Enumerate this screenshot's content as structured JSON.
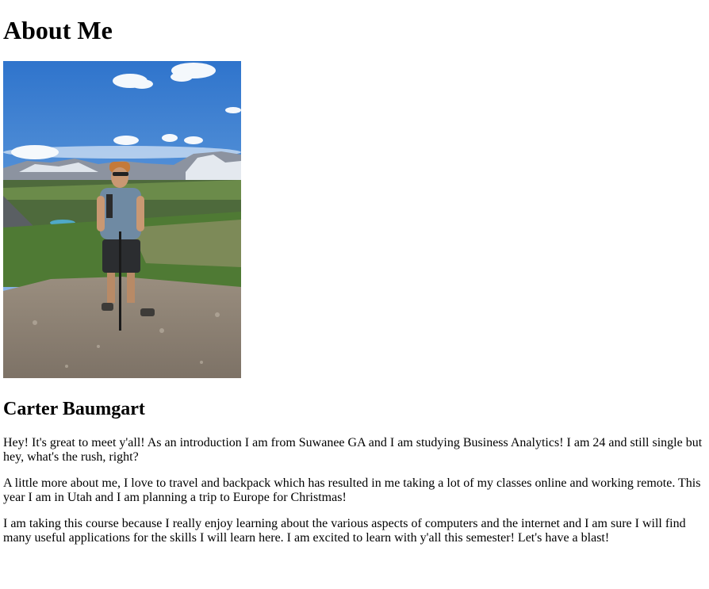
{
  "page": {
    "heading": "About Me",
    "name": "Carter Baumgart",
    "paragraphs": [
      "Hey! It's great to meet y'all! As an introduction I am from Suwanee GA and I am studying Business Analytics! I am 24 and still single but hey, what's the rush, right?",
      "A little more about me, I love to travel and backpack which has resulted in me taking a lot of my classes online and working remote. This year I am in Utah and I am planning a trip to Europe for Christmas!",
      "I am taking this course because I really enjoy learning about the various aspects of computers and the internet and I am sure I will find many useful applications for the skills I will learn here. I am excited to learn with y'all this semester! Let's have a blast!"
    ]
  },
  "photo": {
    "description_icon": "profile-photo",
    "colors": {
      "sky_top": "#3b7fd1",
      "sky_bottom": "#b9d2ee",
      "mountain": "#8a8f99",
      "snow": "#e9eef4",
      "forest": "#3c5a33",
      "meadow": "#5f8a3c",
      "lake": "#4fa9c8",
      "ground": "#8c8173",
      "rock": "#a39888"
    }
  }
}
